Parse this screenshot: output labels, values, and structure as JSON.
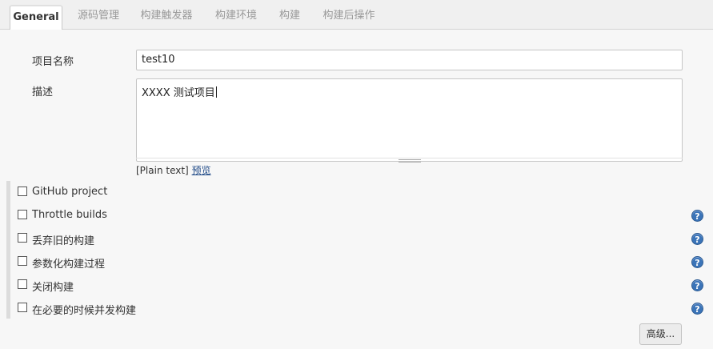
{
  "tabs": [
    {
      "label": "General",
      "active": true
    },
    {
      "label": "源码管理",
      "active": false
    },
    {
      "label": "构建触发器",
      "active": false
    },
    {
      "label": "构建环境",
      "active": false
    },
    {
      "label": "构建",
      "active": false
    },
    {
      "label": "构建后操作",
      "active": false
    }
  ],
  "form": {
    "project_name_label": "项目名称",
    "project_name_value": "test10",
    "description_label": "描述",
    "description_value": "XXXX 测试项目",
    "format_prefix": "[Plain text]",
    "preview_link": "预览"
  },
  "options": [
    {
      "label": "GitHub project",
      "checked": false,
      "has_help": false
    },
    {
      "label": "Throttle builds",
      "checked": false,
      "has_help": true
    },
    {
      "label": "丢弃旧的构建",
      "checked": false,
      "has_help": true
    },
    {
      "label": "参数化构建过程",
      "checked": false,
      "has_help": true
    },
    {
      "label": "关闭构建",
      "checked": false,
      "has_help": true
    },
    {
      "label": "在必要的时候并发构建",
      "checked": false,
      "has_help": true
    }
  ],
  "help_icon_glyph": "?",
  "advanced_button": "高级...",
  "colors": {
    "accent": "#3b74b8",
    "link": "#204a87"
  },
  "icons": {
    "help": "help-icon",
    "checkbox": "checkbox-icon",
    "resize": "resize-grip-icon"
  }
}
